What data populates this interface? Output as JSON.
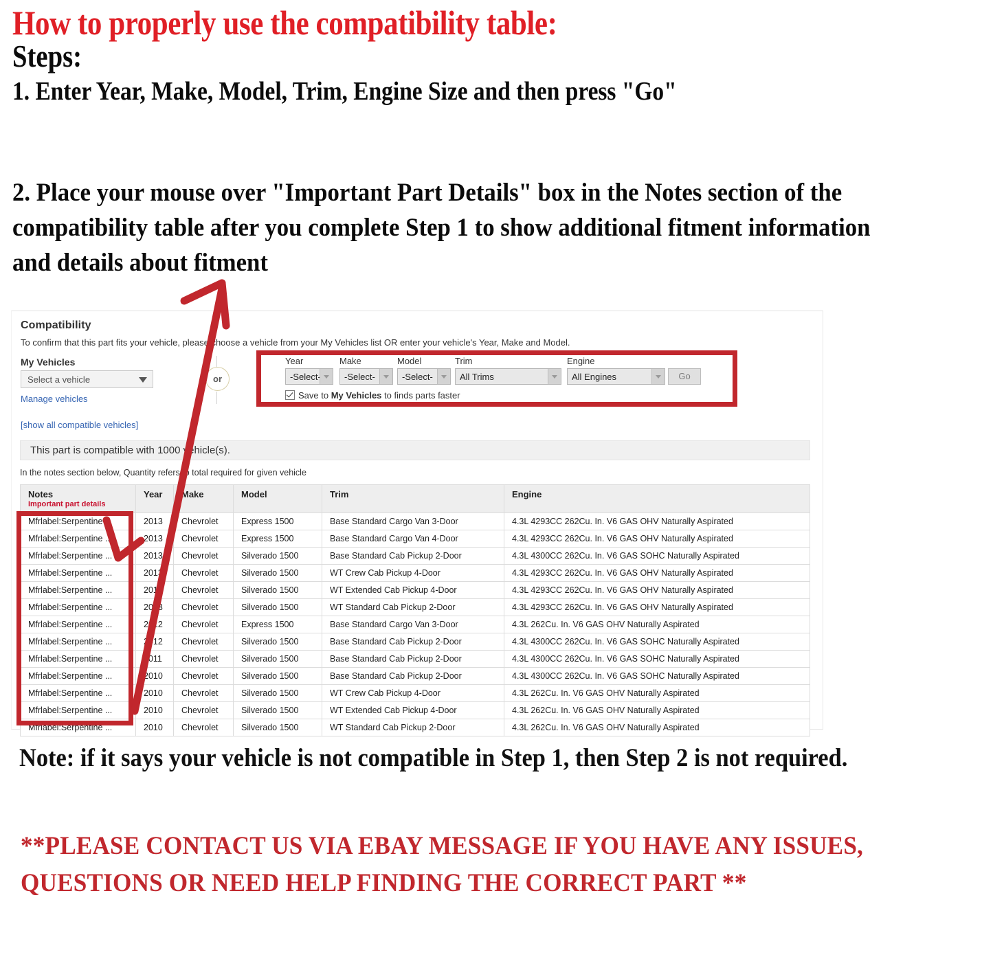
{
  "instructions": {
    "title": "How to properly use the compatibility table:",
    "steps_label": "Steps:",
    "step1": "1. Enter Year, Make, Model, Trim, Engine Size and then press \"Go\"",
    "step2": "2. Place your mouse over \"Important Part Details\" box in the Notes section of the compatibility table after you complete Step 1 to show additional fitment information and details about fitment",
    "note": "Note: if it says your vehicle is not compatible in Step 1, then Step 2 is not required.",
    "contact": "**PLEASE CONTACT US VIA EBAY MESSAGE IF YOU HAVE ANY ISSUES, QUESTIONS OR NEED HELP FINDING THE CORRECT PART **"
  },
  "colors": {
    "red_heading": "#e01f26",
    "annotation_red": "#c1272d",
    "link_blue": "#3665b3",
    "important_red": "#c8102e"
  },
  "compatibility": {
    "title": "Compatibility",
    "subtitle": "To confirm that this part fits your vehicle, please choose a vehicle from your My Vehicles list OR enter your vehicle's Year, Make and Model.",
    "my_vehicles_label": "My Vehicles",
    "vehicle_select_value": "Select a vehicle",
    "manage_link": "Manage vehicles",
    "show_all_link": "[show all compatible vehicles]",
    "or_label": "or",
    "fields": [
      {
        "label": "Year",
        "value": "-Select-"
      },
      {
        "label": "Make",
        "value": "-Select-"
      },
      {
        "label": "Model",
        "value": "-Select-"
      },
      {
        "label": "Trim",
        "value": "All Trims"
      },
      {
        "label": "Engine",
        "value": "All Engines"
      }
    ],
    "go_button": "Go",
    "save_prefix": "Save to ",
    "save_bold": "My Vehicles",
    "save_suffix": " to finds parts faster",
    "count_message": "This part is compatible with 1000 vehicle(s).",
    "quantity_hint": "In the notes section below, Quantity refers to total required for given vehicle",
    "table": {
      "headers": {
        "notes": "Notes",
        "notes_sub": "Important part details",
        "year": "Year",
        "make": "Make",
        "model": "Model",
        "trim": "Trim",
        "engine": "Engine"
      },
      "rows": [
        {
          "notes": "Mfrlabel:Serpentine ...",
          "year": "2013",
          "make": "Chevrolet",
          "model": "Express 1500",
          "trim": "Base Standard Cargo Van 3-Door",
          "engine": "4.3L 4293CC 262Cu. In. V6 GAS OHV Naturally Aspirated"
        },
        {
          "notes": "Mfrlabel:Serpentine ...",
          "year": "2013",
          "make": "Chevrolet",
          "model": "Express 1500",
          "trim": "Base Standard Cargo Van 4-Door",
          "engine": "4.3L 4293CC 262Cu. In. V6 GAS OHV Naturally Aspirated"
        },
        {
          "notes": "Mfrlabel:Serpentine ...",
          "year": "2013",
          "make": "Chevrolet",
          "model": "Silverado 1500",
          "trim": "Base Standard Cab Pickup 2-Door",
          "engine": "4.3L 4300CC 262Cu. In. V6 GAS SOHC Naturally Aspirated"
        },
        {
          "notes": "Mfrlabel:Serpentine ...",
          "year": "2013",
          "make": "Chevrolet",
          "model": "Silverado 1500",
          "trim": "WT Crew Cab Pickup 4-Door",
          "engine": "4.3L 4293CC 262Cu. In. V6 GAS OHV Naturally Aspirated"
        },
        {
          "notes": "Mfrlabel:Serpentine ...",
          "year": "2013",
          "make": "Chevrolet",
          "model": "Silverado 1500",
          "trim": "WT Extended Cab Pickup 4-Door",
          "engine": "4.3L 4293CC 262Cu. In. V6 GAS OHV Naturally Aspirated"
        },
        {
          "notes": "Mfrlabel:Serpentine ...",
          "year": "2013",
          "make": "Chevrolet",
          "model": "Silverado 1500",
          "trim": "WT Standard Cab Pickup 2-Door",
          "engine": "4.3L 4293CC 262Cu. In. V6 GAS OHV Naturally Aspirated"
        },
        {
          "notes": "Mfrlabel:Serpentine ...",
          "year": "2012",
          "make": "Chevrolet",
          "model": "Express 1500",
          "trim": "Base Standard Cargo Van 3-Door",
          "engine": "4.3L 262Cu. In. V6 GAS OHV Naturally Aspirated"
        },
        {
          "notes": "Mfrlabel:Serpentine ...",
          "year": "2012",
          "make": "Chevrolet",
          "model": "Silverado 1500",
          "trim": "Base Standard Cab Pickup 2-Door",
          "engine": "4.3L 4300CC 262Cu. In. V6 GAS SOHC Naturally Aspirated"
        },
        {
          "notes": "Mfrlabel:Serpentine ...",
          "year": "2011",
          "make": "Chevrolet",
          "model": "Silverado 1500",
          "trim": "Base Standard Cab Pickup 2-Door",
          "engine": "4.3L 4300CC 262Cu. In. V6 GAS SOHC Naturally Aspirated"
        },
        {
          "notes": "Mfrlabel:Serpentine ...",
          "year": "2010",
          "make": "Chevrolet",
          "model": "Silverado 1500",
          "trim": "Base Standard Cab Pickup 2-Door",
          "engine": "4.3L 4300CC 262Cu. In. V6 GAS SOHC Naturally Aspirated"
        },
        {
          "notes": "Mfrlabel:Serpentine ...",
          "year": "2010",
          "make": "Chevrolet",
          "model": "Silverado 1500",
          "trim": "WT Crew Cab Pickup 4-Door",
          "engine": "4.3L 262Cu. In. V6 GAS OHV Naturally Aspirated"
        },
        {
          "notes": "Mfrlabel:Serpentine ...",
          "year": "2010",
          "make": "Chevrolet",
          "model": "Silverado 1500",
          "trim": "WT Extended Cab Pickup 4-Door",
          "engine": "4.3L 262Cu. In. V6 GAS OHV Naturally Aspirated"
        },
        {
          "notes": "Mfrlabel:Serpentine ...",
          "year": "2010",
          "make": "Chevrolet",
          "model": "Silverado 1500",
          "trim": "WT Standard Cab Pickup 2-Door",
          "engine": "4.3L 262Cu. In. V6 GAS OHV Naturally Aspirated"
        }
      ]
    }
  }
}
